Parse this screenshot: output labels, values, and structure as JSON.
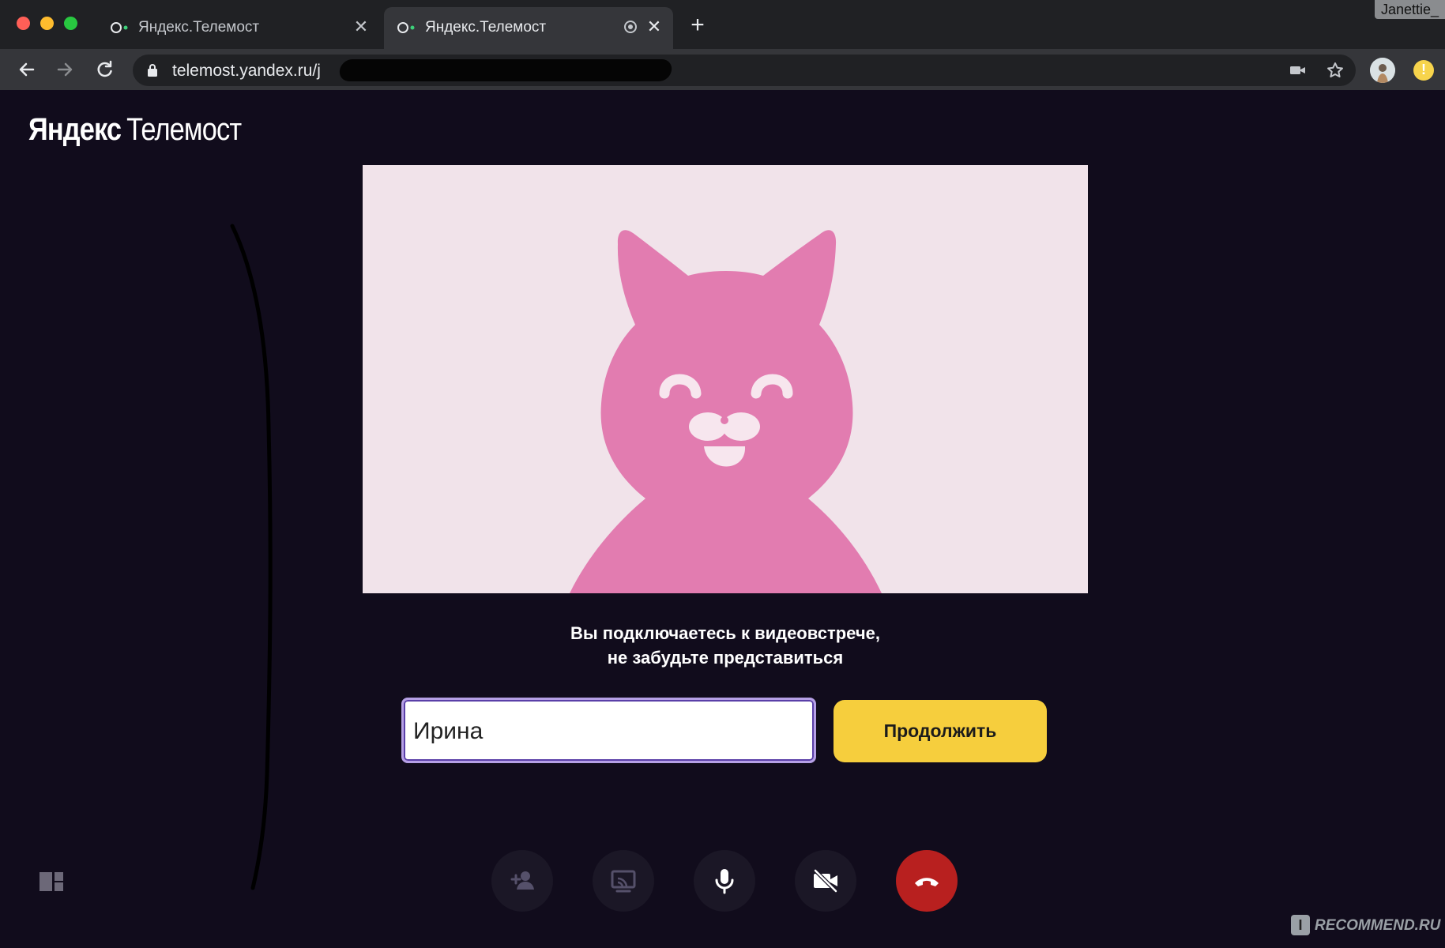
{
  "browser": {
    "tabs": [
      {
        "title": "Яндекс.Телемост",
        "active": false
      },
      {
        "title": "Яндекс.Телемост",
        "active": true
      }
    ],
    "profile_name": "Janettie_",
    "url": "telemost.yandex.ru/j",
    "icons": [
      "back-arrow-icon",
      "forward-arrow-icon",
      "reload-icon",
      "lock-icon",
      "camera-icon",
      "star-icon",
      "new-tab-plus-icon",
      "close-icon",
      "recording-icon"
    ]
  },
  "page": {
    "logo": {
      "part1": "Яндекс",
      "part2": "Телемост"
    },
    "prompt": {
      "line1": "Вы подключаетесь к видеовстрече,",
      "line2": "не забудьте представиться"
    },
    "name_input": {
      "value": "Ирина"
    },
    "continue_label": "Продолжить",
    "controls": [
      "add-participant-icon",
      "screen-share-icon",
      "microphone-icon",
      "camera-off-icon",
      "hang-up-icon"
    ],
    "colors": {
      "background": "#110c1c",
      "preview_bg": "#f1e3ea",
      "avatar_pink": "#e27cb0",
      "accent_yellow": "#f6ce3d",
      "hangup_red": "#b8201f"
    }
  },
  "watermark": {
    "badge": "I",
    "text": "RECOMMEND.RU"
  }
}
